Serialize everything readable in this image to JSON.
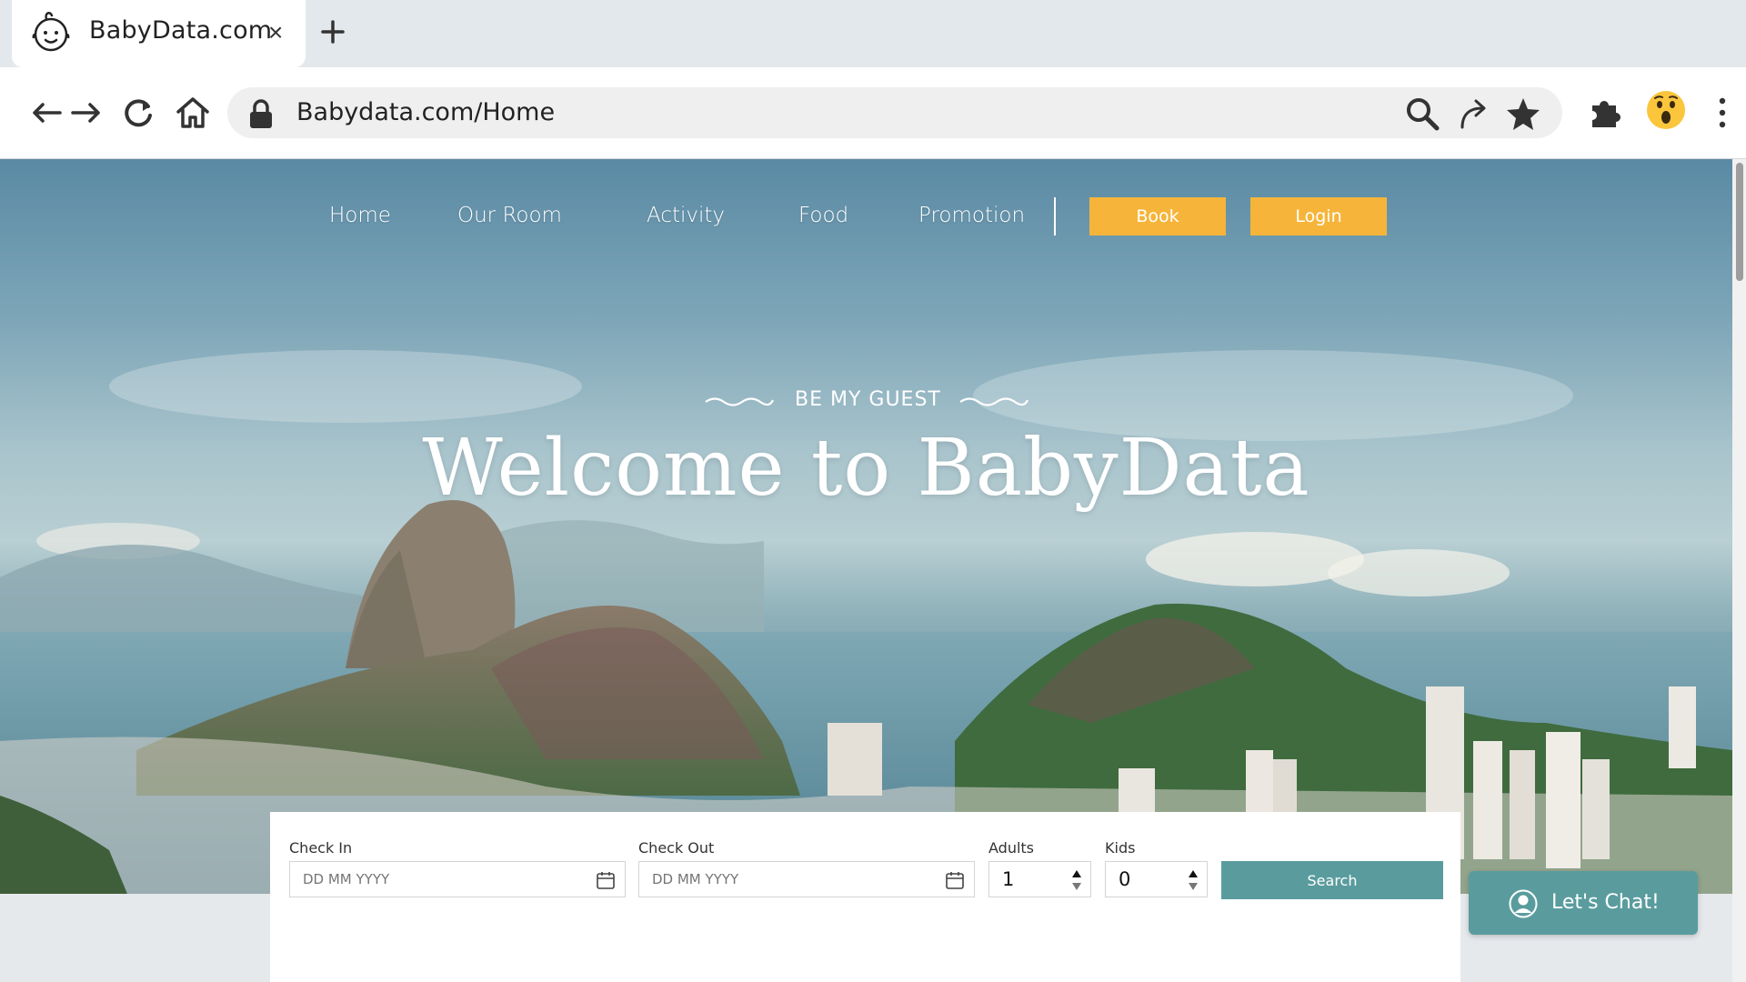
{
  "browser": {
    "tab": {
      "title": "BabyData.com",
      "close_glyph": "×",
      "icon": "baby-face-icon"
    },
    "new_tab_icon": "plus-icon",
    "toolbar": {
      "back_icon": "back-arrow-icon",
      "forward_icon": "forward-arrow-icon",
      "reload_icon": "reload-icon",
      "home_icon": "home-icon",
      "url": "Babydata.com/Home",
      "omnibox_icons": [
        "lock-icon",
        "search-icon",
        "share-icon",
        "star-icon"
      ],
      "extension_icons": [
        "puzzle-icon",
        "profile-emoji-icon",
        "more-vertical-icon"
      ]
    }
  },
  "site": {
    "nav": {
      "links": [
        "Home",
        "Our Room",
        "Activity",
        "Food",
        "Promotion"
      ],
      "book_label": "Book",
      "login_label": "Login",
      "button_color": "#f6b53a"
    },
    "hero": {
      "tagline": "BE MY GUEST",
      "headline": "Welcome to BabyData"
    },
    "booking": {
      "check_in": {
        "label": "Check In",
        "placeholder": "DD MM YYYY"
      },
      "check_out": {
        "label": "Check Out",
        "placeholder": "DD MM YYYY"
      },
      "adults": {
        "label": "Adults",
        "value": "1"
      },
      "kids": {
        "label": "Kids",
        "value": "0"
      },
      "search_label": "Search",
      "accent_color": "#5a9c9e"
    },
    "chat": {
      "label": "Let's Chat!",
      "icon": "user-avatar-icon"
    }
  }
}
